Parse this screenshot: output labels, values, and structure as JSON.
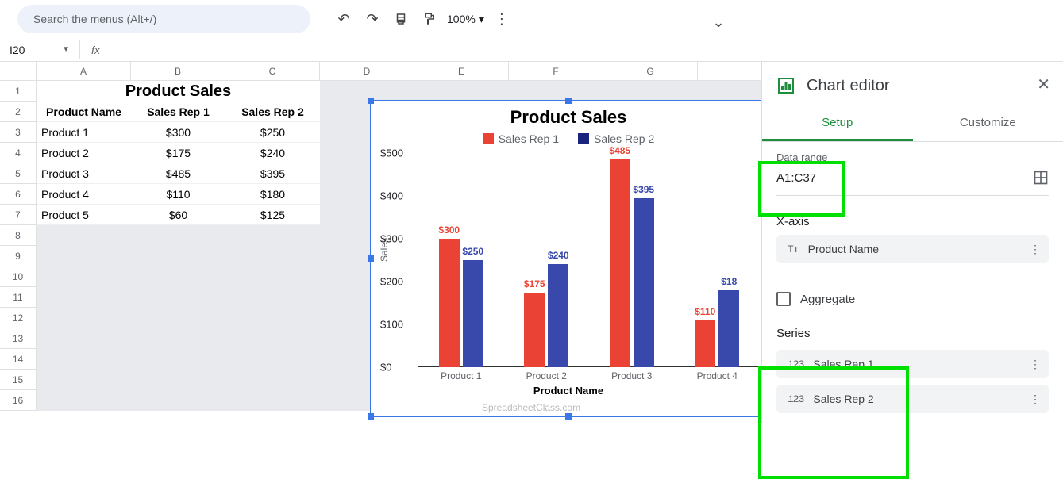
{
  "toolbar": {
    "search_placeholder": "Search the menus (Alt+/)",
    "zoom": "100%"
  },
  "formula_bar": {
    "cell_ref": "I20",
    "fx": "fx"
  },
  "columns": [
    "A",
    "B",
    "C",
    "D",
    "E",
    "F",
    "G"
  ],
  "rows": [
    "1",
    "2",
    "3",
    "4",
    "5",
    "6",
    "7",
    "8",
    "9",
    "10",
    "11",
    "12",
    "13",
    "14",
    "15",
    "16"
  ],
  "sheet": {
    "title": "Product Sales",
    "headers": [
      "Product Name",
      "Sales Rep 1",
      "Sales Rep 2"
    ],
    "data": [
      [
        "Product 1",
        "$300",
        "$250"
      ],
      [
        "Product 2",
        "$175",
        "$240"
      ],
      [
        "Product 3",
        "$485",
        "$395"
      ],
      [
        "Product 4",
        "$110",
        "$180"
      ],
      [
        "Product 5",
        "$60",
        "$125"
      ]
    ]
  },
  "chart_data": {
    "type": "bar",
    "title": "Product Sales",
    "xlabel": "Product Name",
    "ylabel": "Sales",
    "ylim": [
      0,
      500
    ],
    "y_ticks": [
      "$0",
      "$100",
      "$200",
      "$300",
      "$400",
      "$500"
    ],
    "categories": [
      "Product 1",
      "Product 2",
      "Product 3",
      "Product 4"
    ],
    "series": [
      {
        "name": "Sales Rep 1",
        "color": "#ea4335",
        "values": [
          300,
          175,
          485,
          110
        ],
        "labels": [
          "$300",
          "$175",
          "$485",
          "$110"
        ]
      },
      {
        "name": "Sales Rep 2",
        "color": "#3949ab",
        "values": [
          250,
          240,
          395,
          180
        ],
        "labels": [
          "$250",
          "$240",
          "$395",
          "$18"
        ]
      }
    ],
    "watermark": "SpreadsheetClass.com"
  },
  "editor": {
    "title": "Chart editor",
    "tabs": {
      "setup": "Setup",
      "customize": "Customize"
    },
    "data_range_label": "Data range",
    "data_range": "A1:C37",
    "xaxis_label": "X-axis",
    "xaxis_value": "Product Name",
    "aggregate": "Aggregate",
    "series_label": "Series",
    "series": [
      "Sales Rep 1",
      "Sales Rep 2"
    ]
  }
}
